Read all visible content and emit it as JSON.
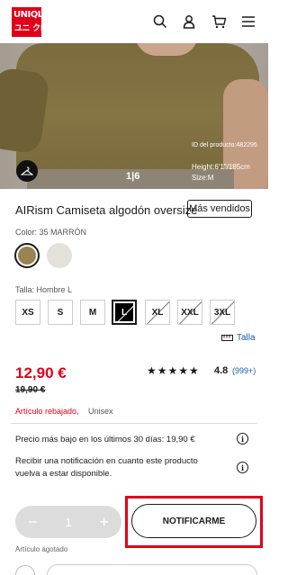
{
  "header": {
    "logo": [
      "UNI",
      "QLO",
      "ユニ",
      "クロ"
    ],
    "icons": [
      "search-icon",
      "account-icon",
      "cart-icon",
      "menu-icon"
    ]
  },
  "hero": {
    "product_id": "ID del producto:482295",
    "height": "Height:6'1\"/185cm",
    "size": "Size:M",
    "pager": "1|6"
  },
  "product": {
    "title": "AIRism Camiseta algodón oversize",
    "badge": "Más vendidos",
    "color_label": "Color: 35 MARRÓN",
    "colors": [
      {
        "name": "marron",
        "hex": "#9a8251",
        "selected": true
      },
      {
        "name": "beige",
        "hex": "#e4e0da",
        "selected": false
      }
    ],
    "size_label": "Talla: Hombre L",
    "sizes": [
      {
        "label": "XS",
        "available": true,
        "selected": false
      },
      {
        "label": "S",
        "available": true,
        "selected": false
      },
      {
        "label": "M",
        "available": true,
        "selected": false
      },
      {
        "label": "L",
        "available": false,
        "selected": true
      },
      {
        "label": "XL",
        "available": false,
        "selected": false
      },
      {
        "label": "XXL",
        "available": false,
        "selected": false
      },
      {
        "label": "3XL",
        "available": false,
        "selected": false
      }
    ],
    "size_guide": "Talla",
    "price": "12,90 €",
    "old_price": "19,90 €",
    "stars": "★★★★★",
    "rating": "4.8",
    "review_count": "(999+)",
    "tag_sale": "Artículo rebajado,",
    "tag_gender": "Unisex",
    "lowest_price": "Precio más bajo en los últimos 30 días: 19,90 €",
    "notify_line1": "Recibir una notificación en cuanto este producto",
    "notify_line2": "vuelva a estar disponible.",
    "info_glyph": "i"
  },
  "purchase": {
    "minus": "−",
    "quantity": "1",
    "plus": "+",
    "notify_button": "NOTIFICARME",
    "out_of_stock": "Artículo agotado"
  },
  "colors": {
    "brand_red": "#e0001a",
    "link_blue": "#1a5ca8"
  }
}
